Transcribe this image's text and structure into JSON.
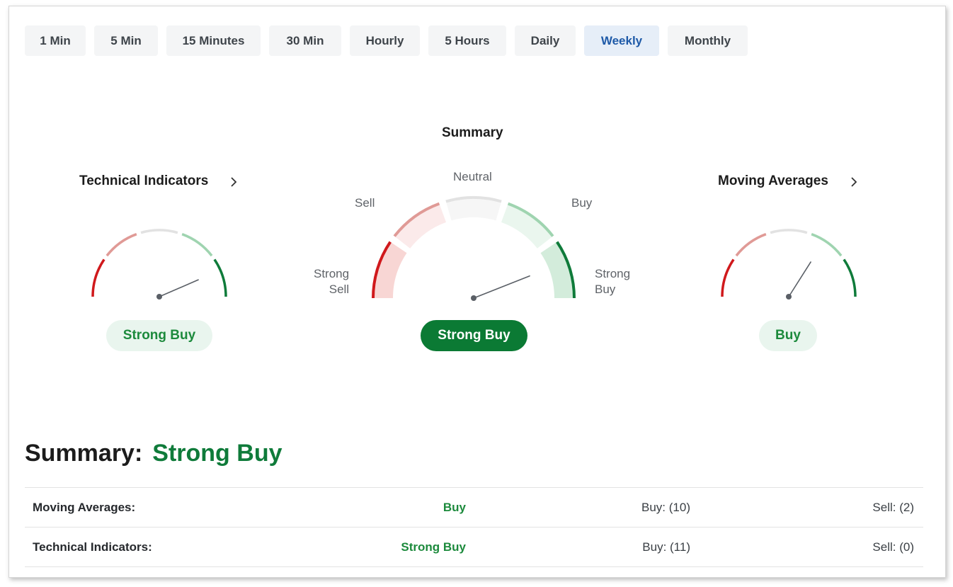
{
  "timeframes": {
    "items": [
      "1 Min",
      "5 Min",
      "15 Minutes",
      "30 Min",
      "Hourly",
      "5 Hours",
      "Daily",
      "Weekly",
      "Monthly"
    ],
    "selected": "Weekly"
  },
  "gauges": {
    "technical": {
      "title": "Technical Indicators",
      "signal": "Strong Buy",
      "needle_value": 0.87
    },
    "summary": {
      "title": "Summary",
      "signal": "Strong Buy",
      "needle_value": 0.88,
      "labels": {
        "strong_sell": "Strong\nSell",
        "sell": "Sell",
        "neutral": "Neutral",
        "buy": "Buy",
        "strong_buy": "Strong\nBuy"
      }
    },
    "moving": {
      "title": "Moving Averages",
      "signal": "Buy",
      "needle_value": 0.68
    }
  },
  "summary_section": {
    "heading": "Summary:",
    "value": "Strong Buy",
    "rows": [
      {
        "name": "Moving Averages:",
        "signal": "Buy",
        "buy": "Buy: (10)",
        "sell": "Sell: (2)"
      },
      {
        "name": "Technical Indicators:",
        "signal": "Strong Buy",
        "buy": "Buy: (11)",
        "sell": "Sell: (0)"
      }
    ]
  },
  "colors": {
    "strong_sell": "#d0191c",
    "sell": "#e09a96",
    "neutral": "#e2e2e2",
    "buy": "#9fd4b0",
    "strong_buy": "#0f7b3a",
    "accent": "#1e5aa8"
  }
}
